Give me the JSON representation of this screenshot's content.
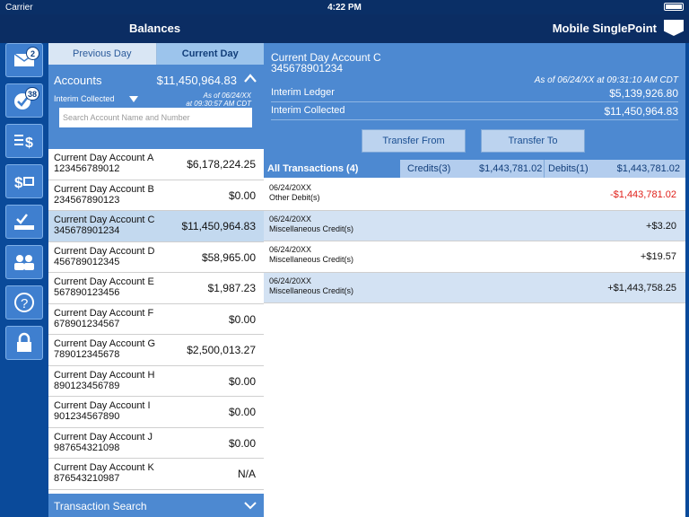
{
  "status": {
    "carrier": "Carrier",
    "time": "4:22 PM"
  },
  "header": {
    "title": "Balances",
    "brand": "Mobile SinglePoint"
  },
  "sidebar": {
    "items": [
      {
        "name": "mail",
        "icon": "envelope-icon",
        "badge": "2"
      },
      {
        "name": "approvals",
        "icon": "checkmark-icon",
        "badge": "38"
      },
      {
        "name": "balances",
        "icon": "dollar-list-icon",
        "badge": ""
      },
      {
        "name": "transfers",
        "icon": "dollar-card-icon",
        "badge": ""
      },
      {
        "name": "deposits",
        "icon": "check-deposit-icon",
        "badge": ""
      },
      {
        "name": "users",
        "icon": "users-icon",
        "badge": ""
      },
      {
        "name": "help",
        "icon": "help-icon",
        "badge": ""
      },
      {
        "name": "logout",
        "icon": "lock-icon",
        "badge": ""
      }
    ]
  },
  "tabs": {
    "previous": "Previous Day",
    "current": "Current Day"
  },
  "accounts": {
    "title": "Accounts",
    "total": "$11,450,964.83",
    "mode": "Interim Collected",
    "asof_line1": "As of 06/24/XX",
    "asof_line2": "at 09:30:57 AM CDT",
    "search_placeholder": "Search Account Name and Number",
    "list": [
      {
        "name": "Current Day Account A",
        "number": "123456789012",
        "amount": "$6,178,224.25"
      },
      {
        "name": "Current Day Account B",
        "number": "234567890123",
        "amount": "$0.00"
      },
      {
        "name": "Current Day Account C",
        "number": "345678901234",
        "amount": "$11,450,964.83"
      },
      {
        "name": "Current Day Account D",
        "number": "456789012345",
        "amount": "$58,965.00"
      },
      {
        "name": "Current Day Account E",
        "number": "567890123456",
        "amount": "$1,987.23"
      },
      {
        "name": "Current Day Account F",
        "number": "678901234567",
        "amount": "$0.00"
      },
      {
        "name": "Current Day Account G",
        "number": "789012345678",
        "amount": "$2,500,013.27"
      },
      {
        "name": "Current Day Account H",
        "number": "890123456789",
        "amount": "$0.00"
      },
      {
        "name": "Current Day Account I",
        "number": "901234567890",
        "amount": "$0.00"
      },
      {
        "name": "Current Day Account J",
        "number": "987654321098",
        "amount": "$0.00"
      },
      {
        "name": "Current Day Account K",
        "number": "876543210987",
        "amount": "N/A"
      }
    ],
    "selected_index": 2
  },
  "transaction_search": {
    "label": "Transaction Search"
  },
  "detail": {
    "name": "Current Day Account C",
    "number": "345678901234",
    "asof": "As of 06/24/XX at 09:31:10 AM CDT",
    "interim_ledger_label": "Interim Ledger",
    "interim_ledger_value": "$5,139,926.80",
    "interim_collected_label": "Interim Collected",
    "interim_collected_value": "$11,450,964.83",
    "transfer_from": "Transfer From",
    "transfer_to": "Transfer To"
  },
  "filter": {
    "all": "All Transactions (4)",
    "credits": "Credits(3)",
    "credits_amount": "$1,443,781.02",
    "debits": "Debits(1)",
    "debits_amount": "$1,443,781.02"
  },
  "transactions": [
    {
      "date": "06/24/20XX",
      "type": "Other Debit(s)",
      "amount": "-$1,443,781.02",
      "negative": true
    },
    {
      "date": "06/24/20XX",
      "type": "Miscellaneous Credit(s)",
      "amount": "+$3.20",
      "negative": false
    },
    {
      "date": "06/24/20XX",
      "type": "Miscellaneous Credit(s)",
      "amount": "+$19.57",
      "negative": false
    },
    {
      "date": "06/24/20XX",
      "type": "Miscellaneous Credit(s)",
      "amount": "+$1,443,758.25",
      "negative": false
    }
  ],
  "colors": {
    "accent": "#4d89d1",
    "header": "#0b2d63",
    "negative": "#e0201a",
    "selected_row": "#c3d9ef"
  }
}
